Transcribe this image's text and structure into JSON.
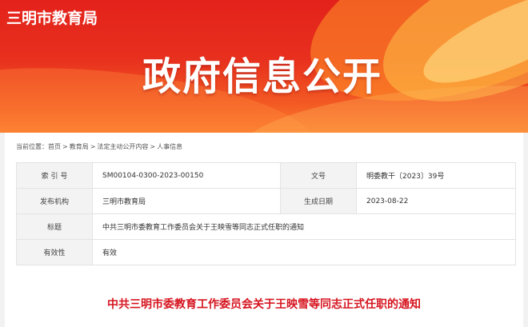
{
  "header": {
    "site_name": "三明市教育局",
    "banner_title": "政府信息公开"
  },
  "breadcrumb": {
    "prefix": "当前位置：",
    "items": [
      "首页",
      "教育局",
      "法定主动公开内容",
      "人事信息"
    ],
    "separator": ">"
  },
  "meta": {
    "index_label": "索 引 号",
    "index_value": "SM00104-0300-2023-00150",
    "doc_no_label": "文号",
    "doc_no_value": "明委教干〔2023〕39号",
    "publisher_label": "发布机构",
    "publisher_value": "三明市教育局",
    "date_label": "生成日期",
    "date_value": "2023-08-22",
    "title_label": "标题",
    "title_value": "中共三明市委教育工作委员会关于王映雪等同志正式任职的通知",
    "validity_label": "有效性",
    "validity_value": "有效"
  },
  "article": {
    "title": "中共三明市委教育工作委员会关于王映雪等同志正式任职的通知"
  },
  "colors": {
    "banner_red": "#e3221b",
    "banner_orange": "#fb7d2e",
    "title_red": "#d6141f"
  }
}
